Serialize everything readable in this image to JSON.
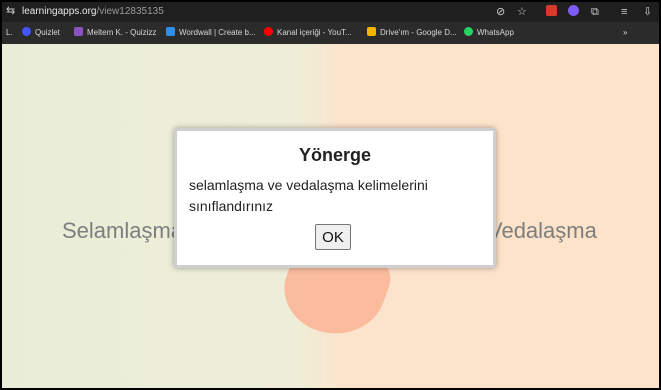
{
  "browser": {
    "url_host": "learningapps.org",
    "url_path": "/view12835135"
  },
  "bookmarks": [
    {
      "label": "Quizlet",
      "icon": "quizlet-icon",
      "color": "#4255ff"
    },
    {
      "label": "Meltem K. - Quizizz",
      "icon": "quizizz-icon",
      "color": "#8854c0"
    },
    {
      "label": "Wordwall | Create b...",
      "icon": "wordwall-icon",
      "color": "#2f8fe8"
    },
    {
      "label": "Kanal içeriği - YouT...",
      "icon": "youtube-icon",
      "color": "#ff0000"
    },
    {
      "label": "Drive'ım - Google D...",
      "icon": "google-drive-icon",
      "color": "#f4b400"
    },
    {
      "label": "WhatsApp",
      "icon": "whatsapp-icon",
      "color": "#25d366"
    }
  ],
  "app": {
    "left_category": "Selamlaşma",
    "right_category": "Vedalaşma"
  },
  "dialog": {
    "title": "Yönerge",
    "message": "selamlaşma ve vedalaşma kelimelerini sınıflandırınız",
    "ok_label": "OK"
  }
}
